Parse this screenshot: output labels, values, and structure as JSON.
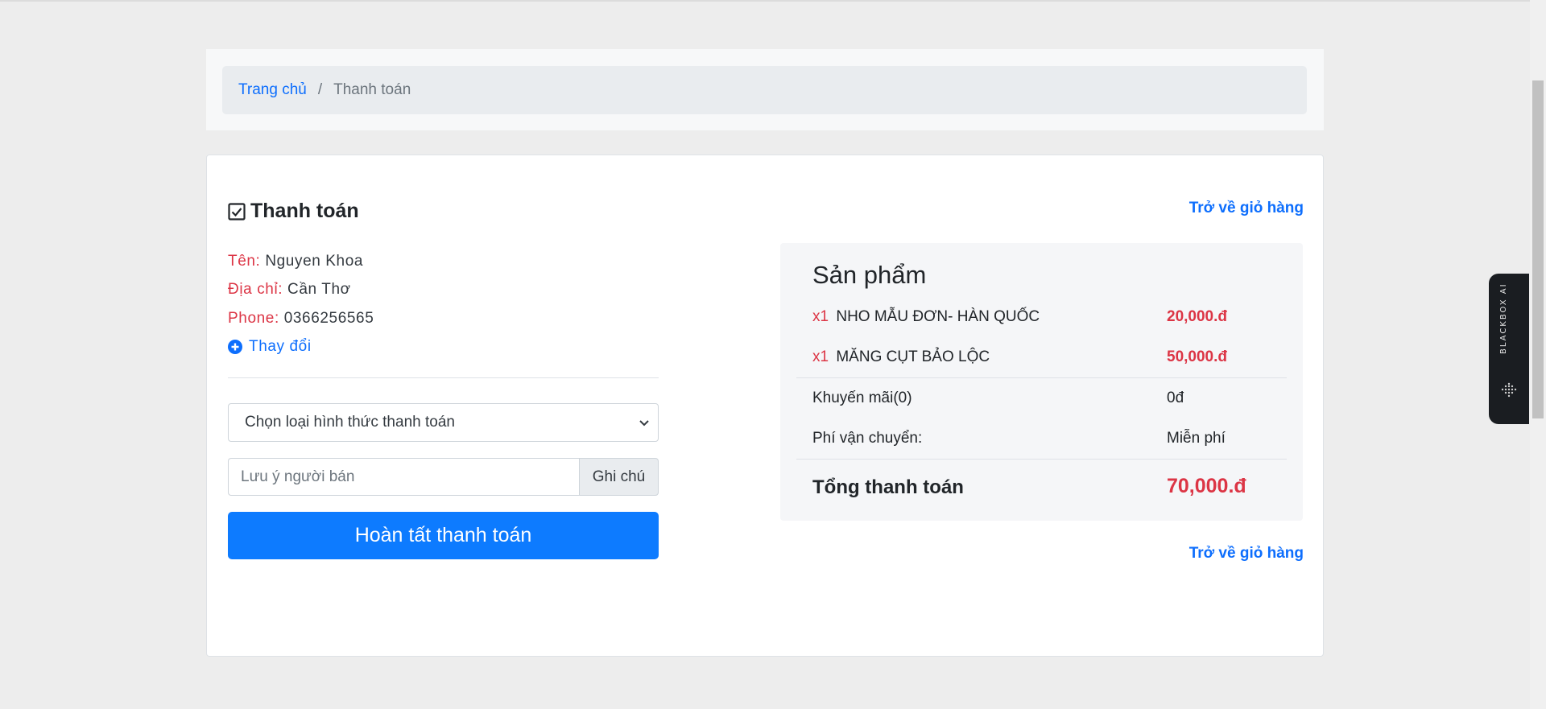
{
  "breadcrumb": {
    "home": "Trang chủ",
    "separator": "/",
    "current": "Thanh toán"
  },
  "checkout": {
    "title": "Thanh toán",
    "back_to_cart": "Trở về giỏ hàng",
    "name_label": "Tên:",
    "name_value": "Nguyen Khoa",
    "address_label": "Địa chỉ:",
    "address_value": "Cần Thơ",
    "phone_label": "Phone:",
    "phone_value": "0366256565",
    "change_label": "Thay đổi",
    "payment_select_value": "Chọn loại hình thức thanh toán",
    "note_placeholder": "Lưu ý người bán",
    "note_addon": "Ghi chú",
    "submit_label": "Hoàn tất thanh toán"
  },
  "summary": {
    "title": "Sản phẩm",
    "items": [
      {
        "qty": "x1",
        "name": "NHO MẪU ĐƠN- HÀN QUỐC",
        "price": "20,000.đ"
      },
      {
        "qty": "x1",
        "name": "MĂNG CỤT BẢO LỘC",
        "price": "50,000.đ"
      }
    ],
    "promo_label": "Khuyến mãi(0)",
    "promo_value": "0đ",
    "shipping_label": "Phí vận chuyển:",
    "shipping_value": "Miễn phí",
    "total_label": "Tổng thanh toán",
    "total_value": "70,000.đ"
  },
  "blackbox": {
    "label": "BLACKBOX AI"
  },
  "colors": {
    "accent": "#0d6efd",
    "danger": "#dc3545",
    "button": "#0d7bff"
  }
}
